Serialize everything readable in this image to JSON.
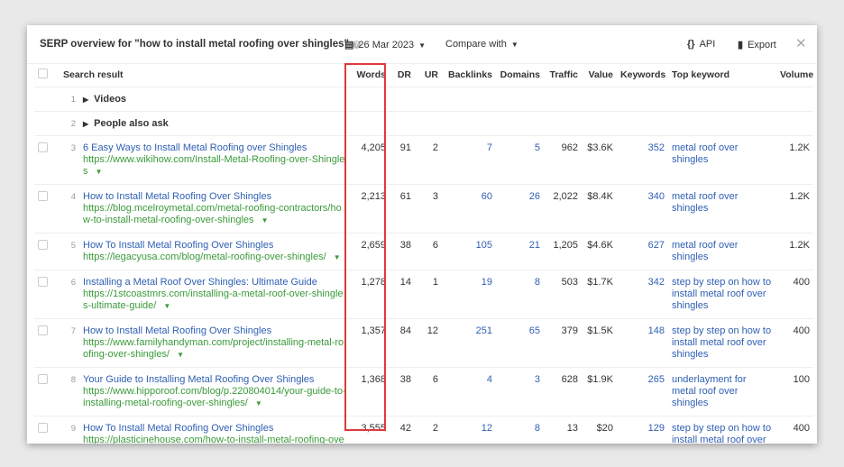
{
  "header": {
    "title": "SERP overview for \"how to install metal roofing over shingles\"",
    "date": "26 Mar 2023",
    "compare": "Compare with",
    "api": "API",
    "export": "Export"
  },
  "columns": [
    "Search result",
    "Words",
    "DR",
    "UR",
    "Backlinks",
    "Domains",
    "Traffic",
    "Value",
    "Keywords",
    "Top keyword",
    "Volume"
  ],
  "groups": [
    {
      "pos": "1",
      "label": "Videos"
    },
    {
      "pos": "2",
      "label": "People also ask"
    }
  ],
  "rows": [
    {
      "pos": "3",
      "title": "6 Easy Ways to Install Metal Roofing over Shingles",
      "url": "https://www.wikihow.com/Install-Metal-Roofing-over-Shingles",
      "words": "4,205",
      "dr": "91",
      "ur": "2",
      "backlinks": "7",
      "domains": "5",
      "traffic": "962",
      "value": "$3.6K",
      "keywords": "352",
      "top_keyword": "metal roof over shingles",
      "volume": "1.2K"
    },
    {
      "pos": "4",
      "title": "How to Install Metal Roofing Over Shingles",
      "url": "https://blog.mcelroymetal.com/metal-roofing-contractors/how-to-install-metal-roofing-over-shingles",
      "words": "2,213",
      "dr": "61",
      "ur": "3",
      "backlinks": "60",
      "domains": "26",
      "traffic": "2,022",
      "value": "$8.4K",
      "keywords": "340",
      "top_keyword": "metal roof over shingles",
      "volume": "1.2K"
    },
    {
      "pos": "5",
      "title": "How To Install Metal Roofing Over Shingles",
      "url": "https://legacyusa.com/blog/metal-roofing-over-shingles/",
      "words": "2,659",
      "dr": "38",
      "ur": "6",
      "backlinks": "105",
      "domains": "21",
      "traffic": "1,205",
      "value": "$4.6K",
      "keywords": "627",
      "top_keyword": "metal roof over shingles",
      "volume": "1.2K"
    },
    {
      "pos": "6",
      "title": "Installing a Metal Roof Over Shingles: Ultimate Guide",
      "url": "https://1stcoastmrs.com/installing-a-metal-roof-over-shingles-ultimate-guide/",
      "words": "1,278",
      "dr": "14",
      "ur": "1",
      "backlinks": "19",
      "domains": "8",
      "traffic": "503",
      "value": "$1.7K",
      "keywords": "342",
      "top_keyword": "step by step on how to install metal roof over shingles",
      "volume": "400"
    },
    {
      "pos": "7",
      "title": "How to Install Metal Roofing Over Shingles",
      "url": "https://www.familyhandyman.com/project/installing-metal-roofing-over-shingles/",
      "words": "1,357",
      "dr": "84",
      "ur": "12",
      "backlinks": "251",
      "domains": "65",
      "traffic": "379",
      "value": "$1.5K",
      "keywords": "148",
      "top_keyword": "step by step on how to install metal roof over shingles",
      "volume": "400"
    },
    {
      "pos": "8",
      "title": "Your Guide to Installing Metal Roofing Over Shingles",
      "url": "https://www.hipporoof.com/blog/p.220804014/your-guide-to-installing-metal-roofing-over-shingles/",
      "words": "1,368",
      "dr": "38",
      "ur": "6",
      "backlinks": "4",
      "domains": "3",
      "traffic": "628",
      "value": "$1.9K",
      "keywords": "265",
      "top_keyword": "underlayment for metal roof over shingles",
      "volume": "100"
    },
    {
      "pos": "9",
      "title": "How To Install Metal Roofing Over Shingles",
      "url": "https://plasticinehouse.com/how-to-install-metal-roofing-over-shingles/",
      "words": "3,555",
      "dr": "42",
      "ur": "2",
      "backlinks": "12",
      "domains": "8",
      "traffic": "13",
      "value": "$20",
      "keywords": "129",
      "top_keyword": "step by step on how to install metal roof over shingles",
      "volume": "400"
    }
  ],
  "colors": {
    "link": "#2f5fb3",
    "url": "#3a9a3a",
    "highlight": "#e03a3a"
  }
}
